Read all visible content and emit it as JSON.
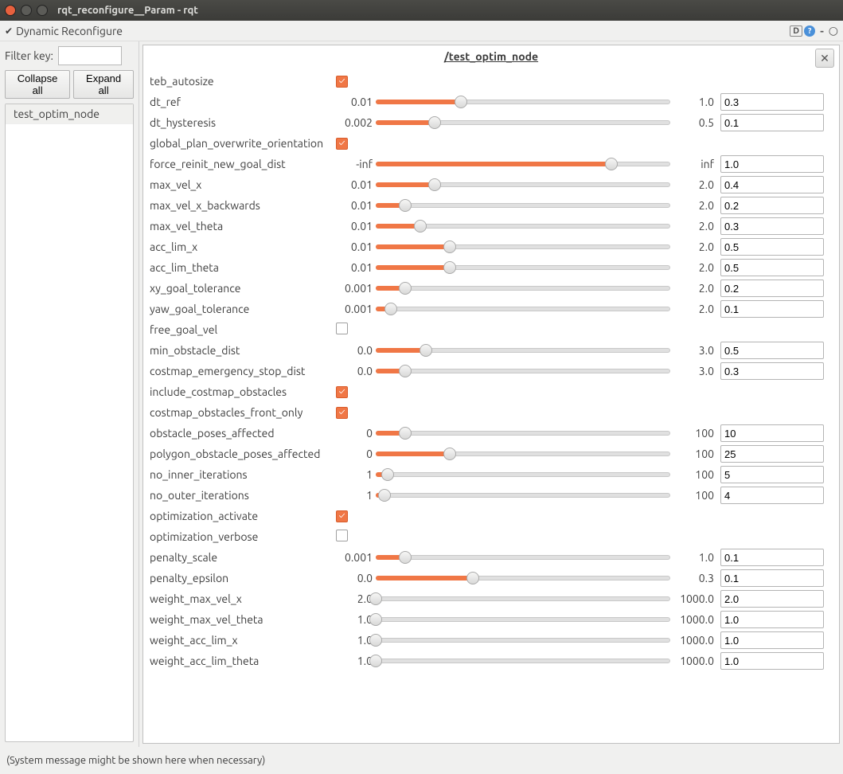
{
  "window": {
    "title": "rqt_reconfigure__Param - rqt"
  },
  "header": {
    "title": "Dynamic Reconfigure",
    "controls": {
      "d": "D",
      "q": "?",
      "dash": "-",
      "o": "○"
    }
  },
  "sidebar": {
    "filter_label": "Filter key:",
    "filter_value": "",
    "collapse": "Collapse all",
    "expand": "Expand all",
    "nodes": [
      "test_optim_node"
    ]
  },
  "content": {
    "title": "/test_optim_node",
    "close": "✕"
  },
  "params": [
    {
      "name": "teb_autosize",
      "type": "bool",
      "value": true
    },
    {
      "name": "dt_ref",
      "type": "double",
      "min": "0.01",
      "max": "1.0",
      "value": "0.3",
      "fill": 29
    },
    {
      "name": "dt_hysteresis",
      "type": "double",
      "min": "0.002",
      "max": "0.5",
      "value": "0.1",
      "fill": 20
    },
    {
      "name": "global_plan_overwrite_orientation",
      "type": "bool",
      "value": true
    },
    {
      "name": "force_reinit_new_goal_dist",
      "type": "double",
      "min": "-inf",
      "max": "inf",
      "value": "1.0",
      "fill": 80
    },
    {
      "name": "max_vel_x",
      "type": "double",
      "min": "0.01",
      "max": "2.0",
      "value": "0.4",
      "fill": 20
    },
    {
      "name": "max_vel_x_backwards",
      "type": "double",
      "min": "0.01",
      "max": "2.0",
      "value": "0.2",
      "fill": 10
    },
    {
      "name": "max_vel_theta",
      "type": "double",
      "min": "0.01",
      "max": "2.0",
      "value": "0.3",
      "fill": 15
    },
    {
      "name": "acc_lim_x",
      "type": "double",
      "min": "0.01",
      "max": "2.0",
      "value": "0.5",
      "fill": 25
    },
    {
      "name": "acc_lim_theta",
      "type": "double",
      "min": "0.01",
      "max": "2.0",
      "value": "0.5",
      "fill": 25
    },
    {
      "name": "xy_goal_tolerance",
      "type": "double",
      "min": "0.001",
      "max": "2.0",
      "value": "0.2",
      "fill": 10
    },
    {
      "name": "yaw_goal_tolerance",
      "type": "double",
      "min": "0.001",
      "max": "2.0",
      "value": "0.1",
      "fill": 5
    },
    {
      "name": "free_goal_vel",
      "type": "bool",
      "value": false
    },
    {
      "name": "min_obstacle_dist",
      "type": "double",
      "min": "0.0",
      "max": "3.0",
      "value": "0.5",
      "fill": 17
    },
    {
      "name": "costmap_emergency_stop_dist",
      "type": "double",
      "min": "0.0",
      "max": "3.0",
      "value": "0.3",
      "fill": 10
    },
    {
      "name": "include_costmap_obstacles",
      "type": "bool",
      "value": true
    },
    {
      "name": "costmap_obstacles_front_only",
      "type": "bool",
      "value": true
    },
    {
      "name": "obstacle_poses_affected",
      "type": "int",
      "min": "0",
      "max": "100",
      "value": "10",
      "fill": 10
    },
    {
      "name": "polygon_obstacle_poses_affected",
      "type": "int",
      "min": "0",
      "max": "100",
      "value": "25",
      "fill": 25
    },
    {
      "name": "no_inner_iterations",
      "type": "int",
      "min": "1",
      "max": "100",
      "value": "5",
      "fill": 4
    },
    {
      "name": "no_outer_iterations",
      "type": "int",
      "min": "1",
      "max": "100",
      "value": "4",
      "fill": 3
    },
    {
      "name": "optimization_activate",
      "type": "bool",
      "value": true
    },
    {
      "name": "optimization_verbose",
      "type": "bool",
      "value": false
    },
    {
      "name": "penalty_scale",
      "type": "double",
      "min": "0.001",
      "max": "1.0",
      "value": "0.1",
      "fill": 10
    },
    {
      "name": "penalty_epsilon",
      "type": "double",
      "min": "0.0",
      "max": "0.3",
      "value": "0.1",
      "fill": 33
    },
    {
      "name": "weight_max_vel_x",
      "type": "double",
      "min": "2.0",
      "max": "1000.0",
      "value": "2.0",
      "fill": 0
    },
    {
      "name": "weight_max_vel_theta",
      "type": "double",
      "min": "1.0",
      "max": "1000.0",
      "value": "1.0",
      "fill": 0
    },
    {
      "name": "weight_acc_lim_x",
      "type": "double",
      "min": "1.0",
      "max": "1000.0",
      "value": "1.0",
      "fill": 0
    },
    {
      "name": "weight_acc_lim_theta",
      "type": "double",
      "min": "1.0",
      "max": "1000.0",
      "value": "1.0",
      "fill": 0
    }
  ],
  "status": "(System message might be shown here when necessary)"
}
